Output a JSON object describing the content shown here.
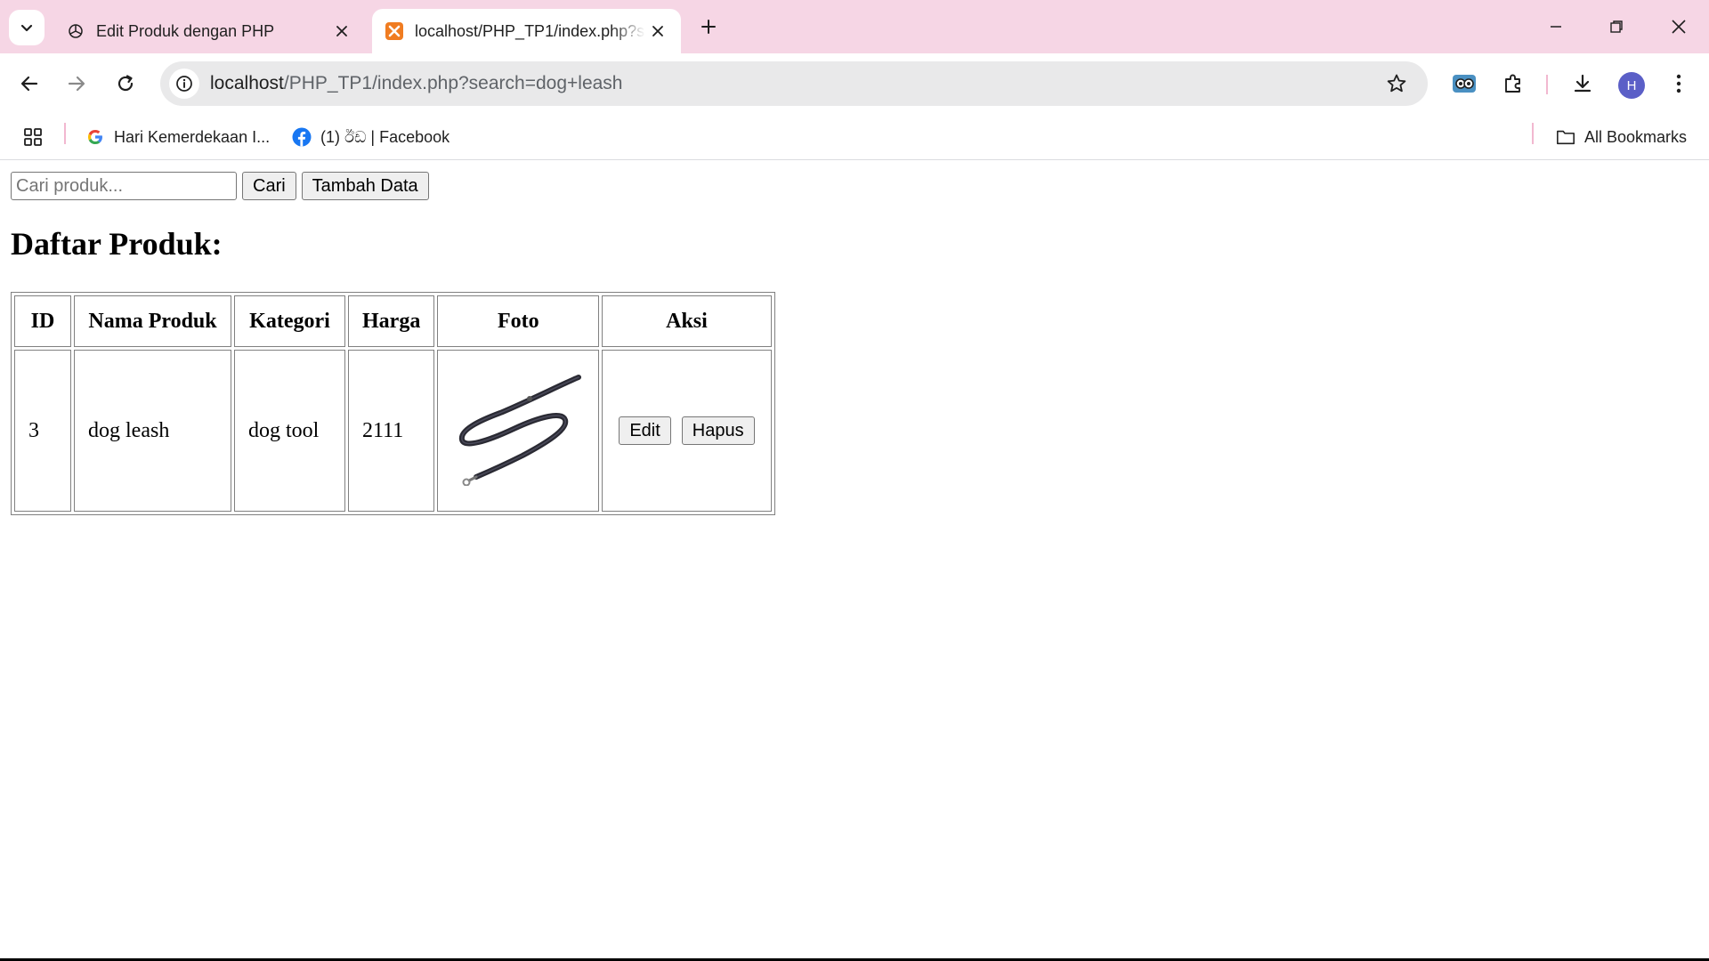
{
  "browser": {
    "tabs": [
      {
        "title": "Edit Produk dengan PHP",
        "active": false,
        "favicon": "openai-icon"
      },
      {
        "title": "localhost/PHP_TP1/index.php?search=dog+leash",
        "active": true,
        "favicon": "xampp-icon"
      }
    ],
    "address": {
      "host": "localhost",
      "path": "/PHP_TP1/index.php?search=dog+leash"
    },
    "avatar_initial": "H",
    "bookmarks": [
      {
        "label": "Hari Kemerdekaan I...",
        "icon": "google-icon"
      },
      {
        "label": "(1) ඊඩ | Facebook",
        "icon": "facebook-icon"
      }
    ],
    "all_bookmarks_label": "All Bookmarks",
    "accent_color": "#f6d6e5"
  },
  "page": {
    "search": {
      "placeholder": "Cari produk...",
      "value": ""
    },
    "search_button": "Cari",
    "add_button": "Tambah Data",
    "heading": "Daftar Produk:",
    "table": {
      "headers": [
        "ID",
        "Nama Produk",
        "Kategori",
        "Harga",
        "Foto",
        "Aksi"
      ],
      "rows": [
        {
          "id": "3",
          "nama": "dog leash",
          "kategori": "dog tool",
          "harga": "2111",
          "foto": "dog-leash-photo",
          "edit": "Edit",
          "hapus": "Hapus"
        }
      ]
    }
  }
}
